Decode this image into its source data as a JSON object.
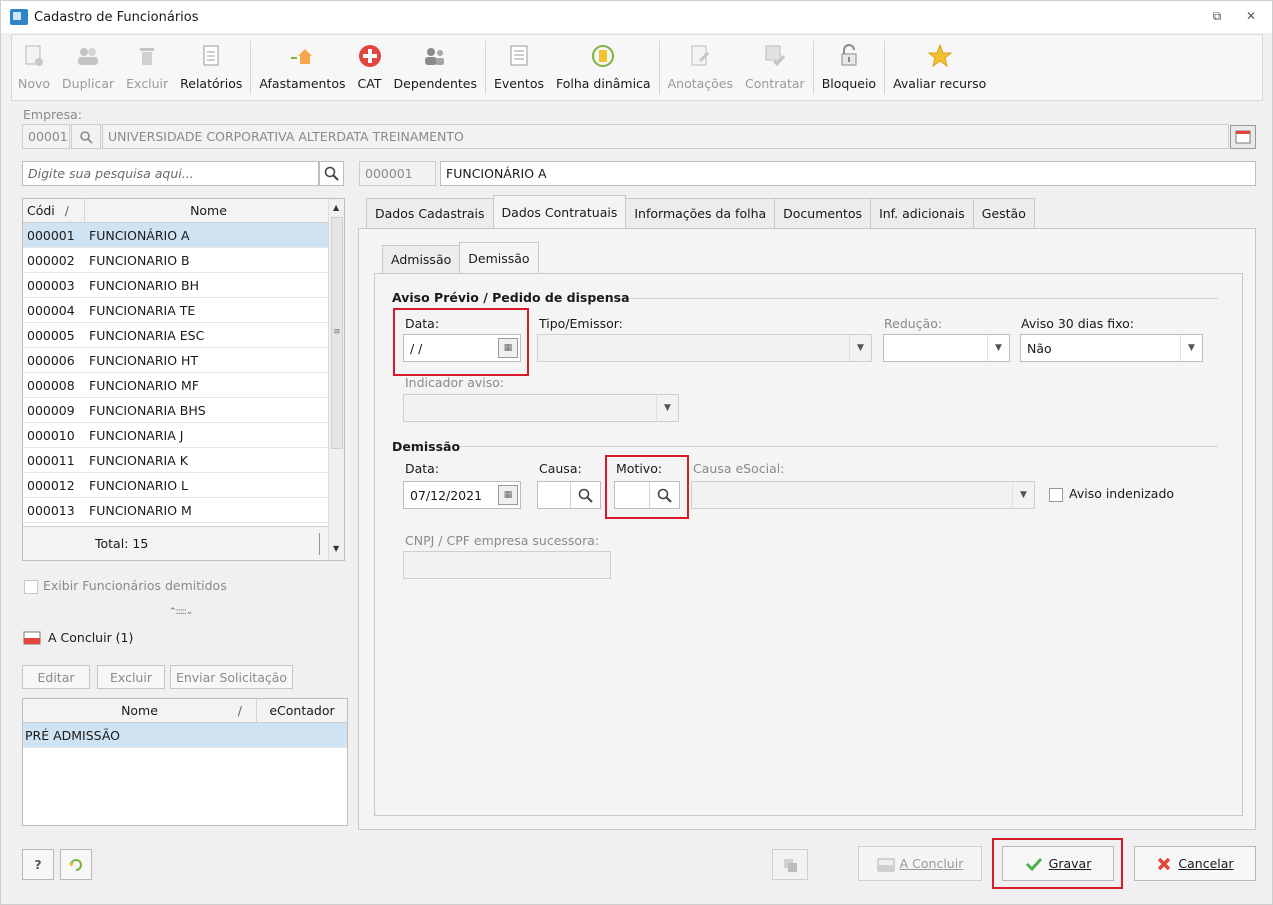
{
  "window": {
    "title": "Cadastro de Funcionários",
    "restore_glyph": "⧉",
    "close_glyph": "✕"
  },
  "toolbar": {
    "items": [
      {
        "label": "Novo",
        "icon": "new-doc-icon",
        "glyph": "▯",
        "enabled": false
      },
      {
        "label": "Duplicar",
        "icon": "users-icon",
        "glyph": "👥",
        "enabled": false
      },
      {
        "label": "Excluir",
        "icon": "trash-icon",
        "glyph": "🗑",
        "enabled": false
      },
      {
        "label": "Relatórios",
        "icon": "report-icon",
        "glyph": "▤",
        "enabled": true
      },
      {
        "label": "Afastamentos",
        "icon": "home-arrow-icon",
        "glyph": "⌂",
        "enabled": true
      },
      {
        "label": "CAT",
        "icon": "medical-cross-icon",
        "glyph": "✚",
        "enabled": true
      },
      {
        "label": "Dependentes",
        "icon": "family-icon",
        "glyph": "👥",
        "enabled": true
      },
      {
        "label": "Eventos",
        "icon": "list-icon",
        "glyph": "☰",
        "enabled": true
      },
      {
        "label": "Folha dinâmica",
        "icon": "calculator-icon",
        "glyph": "▦",
        "enabled": true
      },
      {
        "label": "Anotações",
        "icon": "notes-icon",
        "glyph": "✎",
        "enabled": false
      },
      {
        "label": "Contratar",
        "icon": "contract-icon",
        "glyph": "✔",
        "enabled": false
      },
      {
        "label": "Bloqueio",
        "icon": "lock-icon",
        "glyph": "🔓",
        "enabled": true
      },
      {
        "label": "Avaliar recurso",
        "icon": "star-icon",
        "glyph": "★",
        "enabled": true
      }
    ],
    "colors": {
      "cat": "#e0463d",
      "star": "#f2c12e",
      "calc": "#7ab342"
    }
  },
  "company": {
    "label": "Empresa:",
    "code": "00001",
    "name": "UNIVERSIDADE CORPORATIVA ALTERDATA TREINAMENTO"
  },
  "search": {
    "placeholder": "Digite sua pesquisa aqui..."
  },
  "employee": {
    "code": "000001",
    "name": "FUNCIONÁRIO A"
  },
  "list": {
    "columns": [
      "Códi",
      "Nome"
    ],
    "sort_glyph": "/",
    "rows": [
      {
        "code": "000001",
        "name": "FUNCIONÁRIO A"
      },
      {
        "code": "000002",
        "name": "FUNCIONARIO B"
      },
      {
        "code": "000003",
        "name": "FUNCIONARIO BH"
      },
      {
        "code": "000004",
        "name": "FUNCIONARIA TE"
      },
      {
        "code": "000005",
        "name": "FUNCIONARIA ESC"
      },
      {
        "code": "000006",
        "name": "FUNCIONARIO HT"
      },
      {
        "code": "000008",
        "name": "FUNCIONARIO MF"
      },
      {
        "code": "000009",
        "name": "FUNCIONARIA BHS"
      },
      {
        "code": "000010",
        "name": "FUNCIONARIA J"
      },
      {
        "code": "000011",
        "name": "FUNCIONARIA K"
      },
      {
        "code": "000012",
        "name": "FUNCIONARIO L"
      },
      {
        "code": "000013",
        "name": "FUNCIONARIO M"
      }
    ],
    "total": "Total: 15"
  },
  "show_dismissed": "Exibir Funcionários demitidos",
  "splitter_glyph": "⌃:::::⌄",
  "pending": {
    "title": "A Concluir (1)",
    "buttons": [
      "Editar",
      "Excluir",
      "Enviar Solicitação"
    ],
    "columns": [
      "Nome",
      "eContador"
    ],
    "sort_glyph": "/",
    "rows": [
      {
        "name": "PRÉ ADMISSÃO",
        "econtador": ""
      }
    ]
  },
  "tabs": {
    "main": [
      "Dados Cadastrais",
      "Dados Contratuais",
      "Informações da folha",
      "Documentos",
      "Inf. adicionais",
      "Gestão"
    ],
    "sub": [
      "Admissão",
      "Demissão"
    ]
  },
  "aviso": {
    "title": "Aviso Prévio / Pedido de dispensa",
    "data_label": "Data:",
    "data_value": " / /",
    "tipo_label": "Tipo/Emissor:",
    "reducao_label": "Redução:",
    "aviso30_label": "Aviso 30 dias fixo:",
    "aviso30_value": "Não",
    "indicador_label": "Indicador aviso:"
  },
  "demissao": {
    "title": "Demissão",
    "data_label": "Data:",
    "data_value": "07/12/2021",
    "causa_label": "Causa:",
    "motivo_label": "Motivo:",
    "causa_esocial_label": "Causa eSocial:",
    "aviso_indenizado": "Aviso indenizado",
    "cnpj_label": "CNPJ / CPF empresa sucessora:"
  },
  "footer": {
    "help": "?",
    "a_concluir": "A Concluir",
    "gravar": "Gravar",
    "cancelar": "Cancelar"
  },
  "colors": {
    "selection": "#cfe3f3",
    "highlight": "#d7192a",
    "ok": "#4caf50",
    "cancel": "#e0463d"
  }
}
